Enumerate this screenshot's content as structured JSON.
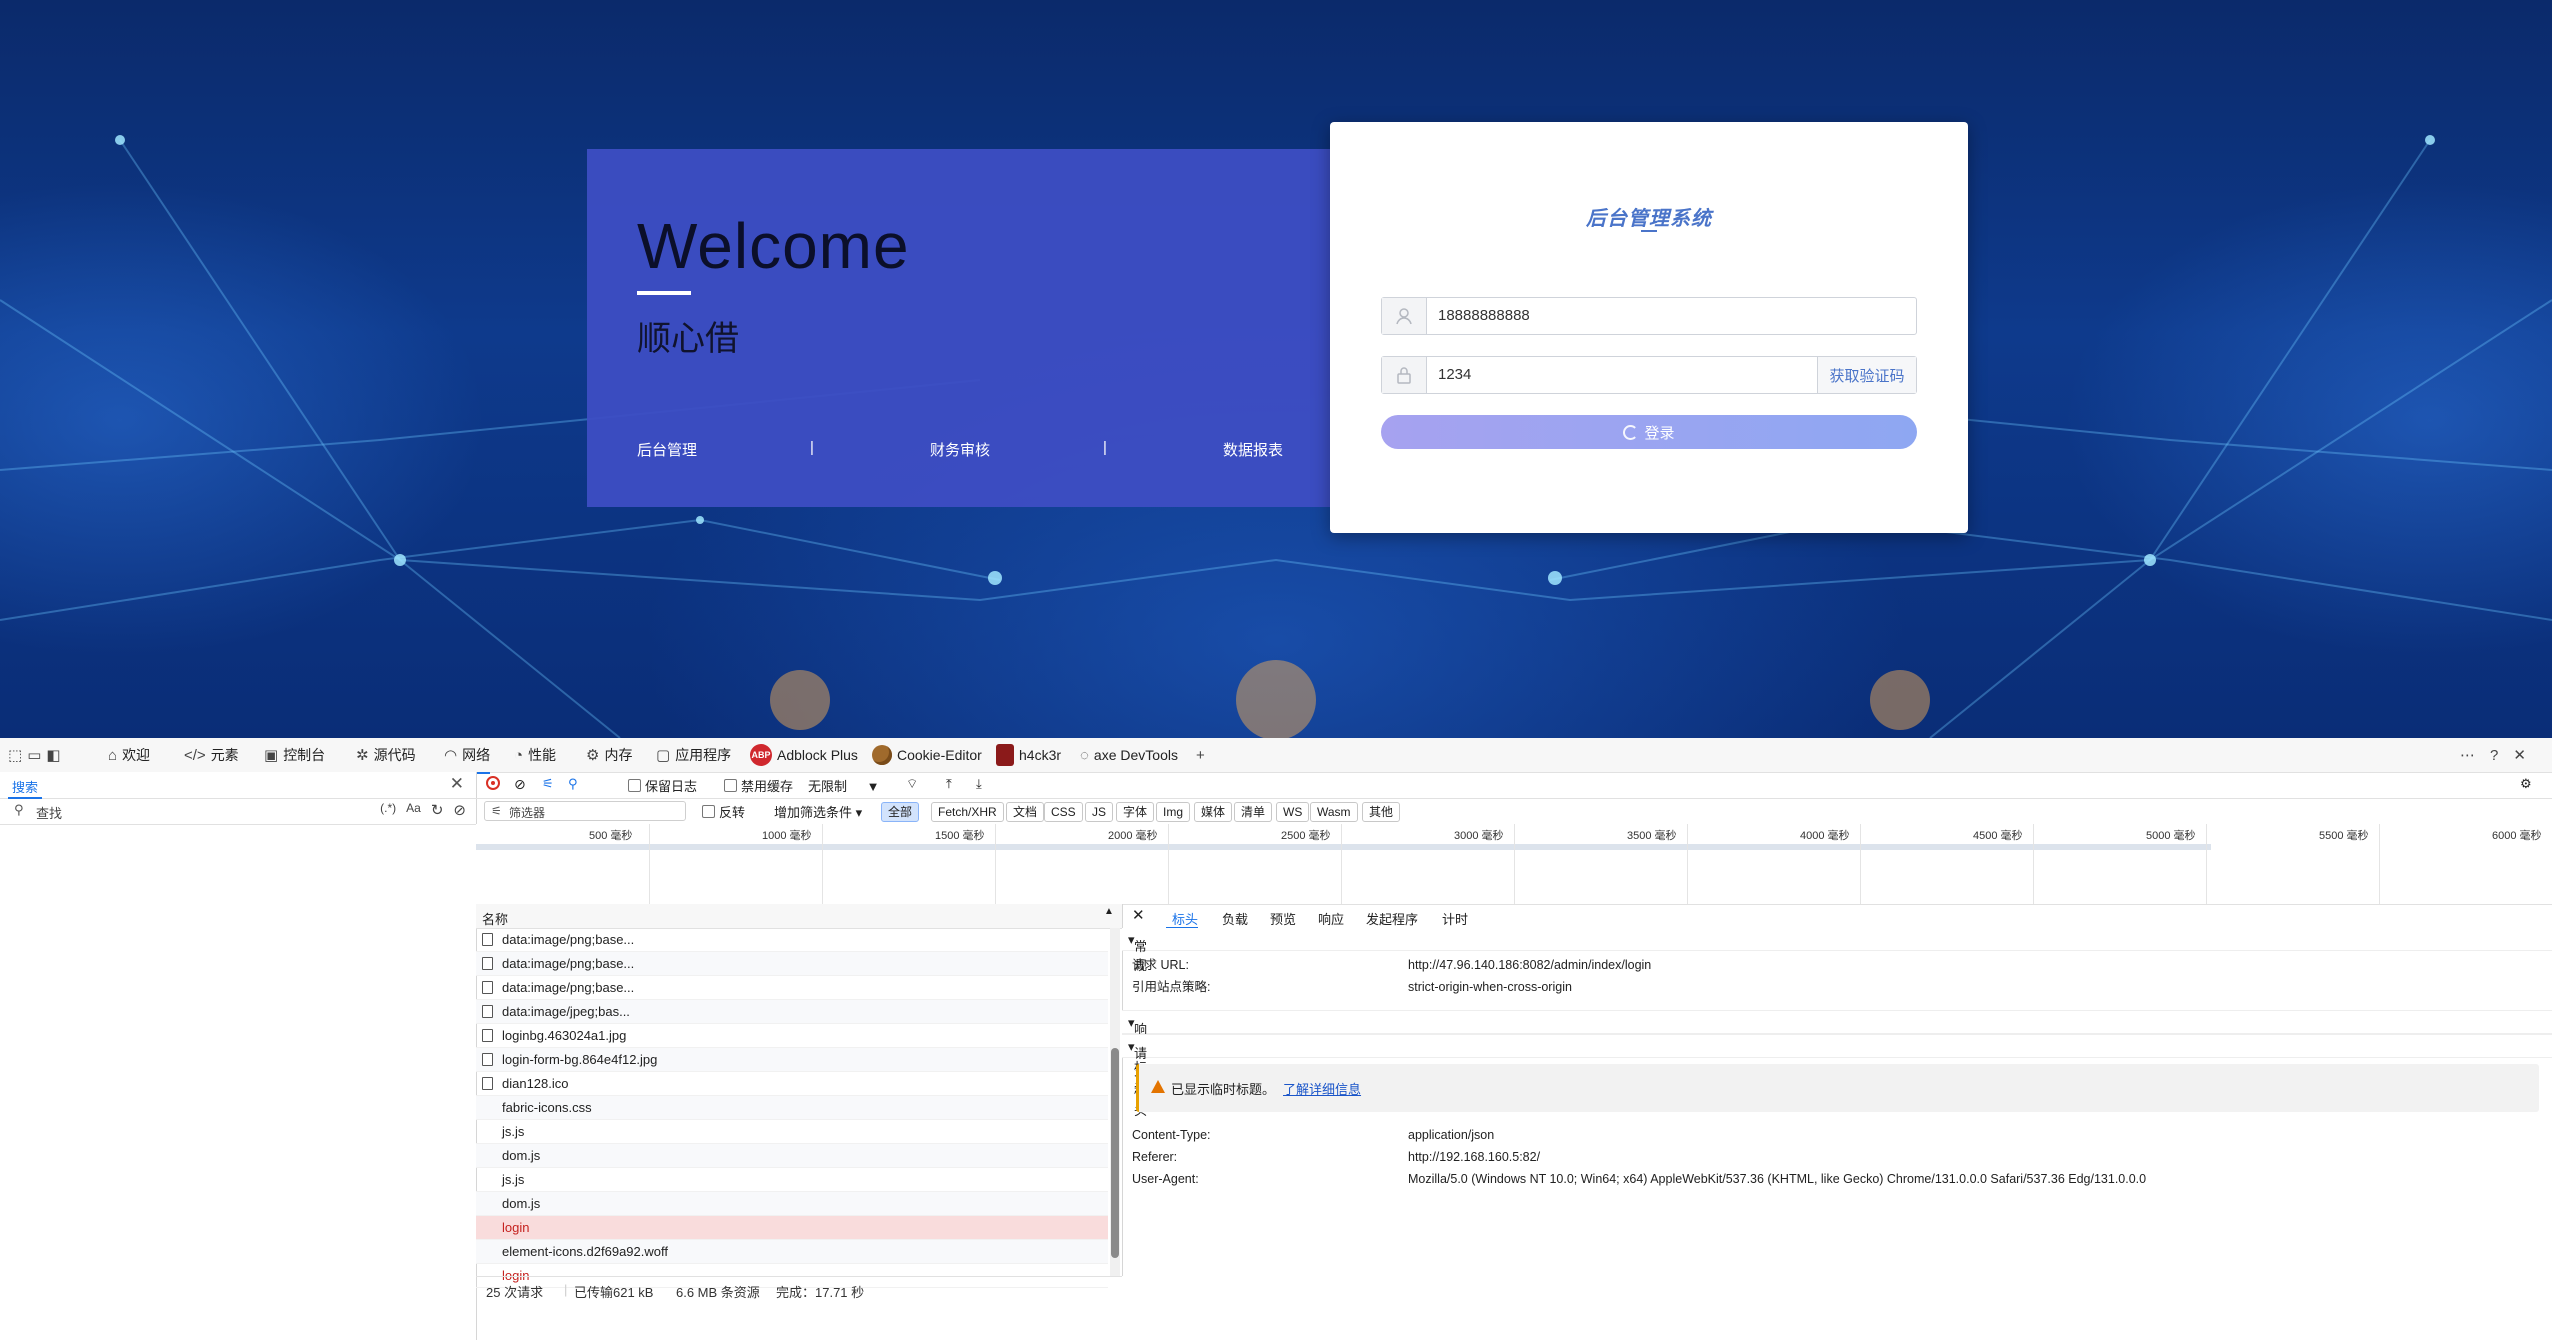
{
  "page": {
    "welcome": {
      "title": "Welcome",
      "subtitle": "顺心借",
      "links": [
        "后台管理",
        "|",
        "财务审核",
        "|",
        "数据报表"
      ]
    },
    "login": {
      "title": "后台管理系统",
      "phone_value": "18888888888",
      "code_value": "1234",
      "get_code_label": "获取验证码",
      "submit_label": "登录"
    }
  },
  "devtools": {
    "toolbar_tabs": [
      "欢迎",
      "元素",
      "控制台",
      "源代码",
      "网络",
      "性能",
      "内存",
      "应用程序",
      "Adblock Plus",
      "Cookie-Editor",
      "h4ck3r",
      "axe DevTools"
    ],
    "left_pane": {
      "tab_label": "搜索",
      "find_placeholder": "查找",
      "opt_regex": "(.*)",
      "opt_case": "Aa"
    },
    "net_toolbar": {
      "preserve_log": "保留日志",
      "disable_cache": "禁用缓存",
      "throttle": "无限制"
    },
    "filter": {
      "placeholder": "筛选器",
      "invert": "反转",
      "more_filters": "增加筛选条件",
      "chips": [
        "全部",
        "Fetch/XHR",
        "文档",
        "CSS",
        "JS",
        "字体",
        "Img",
        "媒体",
        "清单",
        "WS",
        "Wasm",
        "其他"
      ]
    },
    "timeline": [
      "500 毫秒",
      "1000 毫秒",
      "1500 毫秒",
      "2000 毫秒",
      "2500 毫秒",
      "3000 毫秒",
      "3500 毫秒",
      "4000 毫秒",
      "4500 毫秒",
      "5000 毫秒",
      "5500 毫秒",
      "6000 毫秒"
    ],
    "list_header": "名称",
    "requests": [
      "data:image/png;base...",
      "data:image/png;base...",
      "data:image/png;base...",
      "data:image/jpeg;bas...",
      "loginbg.463024a1.jpg",
      "login-form-bg.864e4f12.jpg",
      "dian128.ico",
      "fabric-icons.css",
      "js.js",
      "dom.js",
      "js.js",
      "dom.js",
      "login",
      "element-icons.d2f69a92.woff",
      "login"
    ],
    "status": {
      "requests": "25 次请求",
      "transferred": "已传输621 kB",
      "resources": "6.6 MB 条资源",
      "finish": "完成：17.71 秒"
    },
    "details": {
      "tabs": [
        "标头",
        "负载",
        "预览",
        "响应",
        "发起程序",
        "计时"
      ],
      "general": "常规",
      "request_url_label": "请求 URL:",
      "request_url": "http://47.96.140.186:8082/admin/index/login",
      "referrer_policy_label": "引用站点策略:",
      "referrer_policy": "strict-origin-when-cross-origin",
      "response_headers": "响应标头",
      "request_headers": "请求标头",
      "warning": "已显示临时标题。",
      "learn_more": "了解详细信息",
      "content_type_label": "Content-Type:",
      "content_type": "application/json",
      "referer_label": "Referer:",
      "referer": "http://192.168.160.5:82/",
      "user_agent_label": "User-Agent:",
      "user_agent": "Mozilla/5.0 (Windows NT 10.0; Win64; x64) AppleWebKit/537.36 (KHTML, like Gecko) Chrome/131.0.0.0 Safari/537.36 Edg/131.0.0.0"
    }
  }
}
